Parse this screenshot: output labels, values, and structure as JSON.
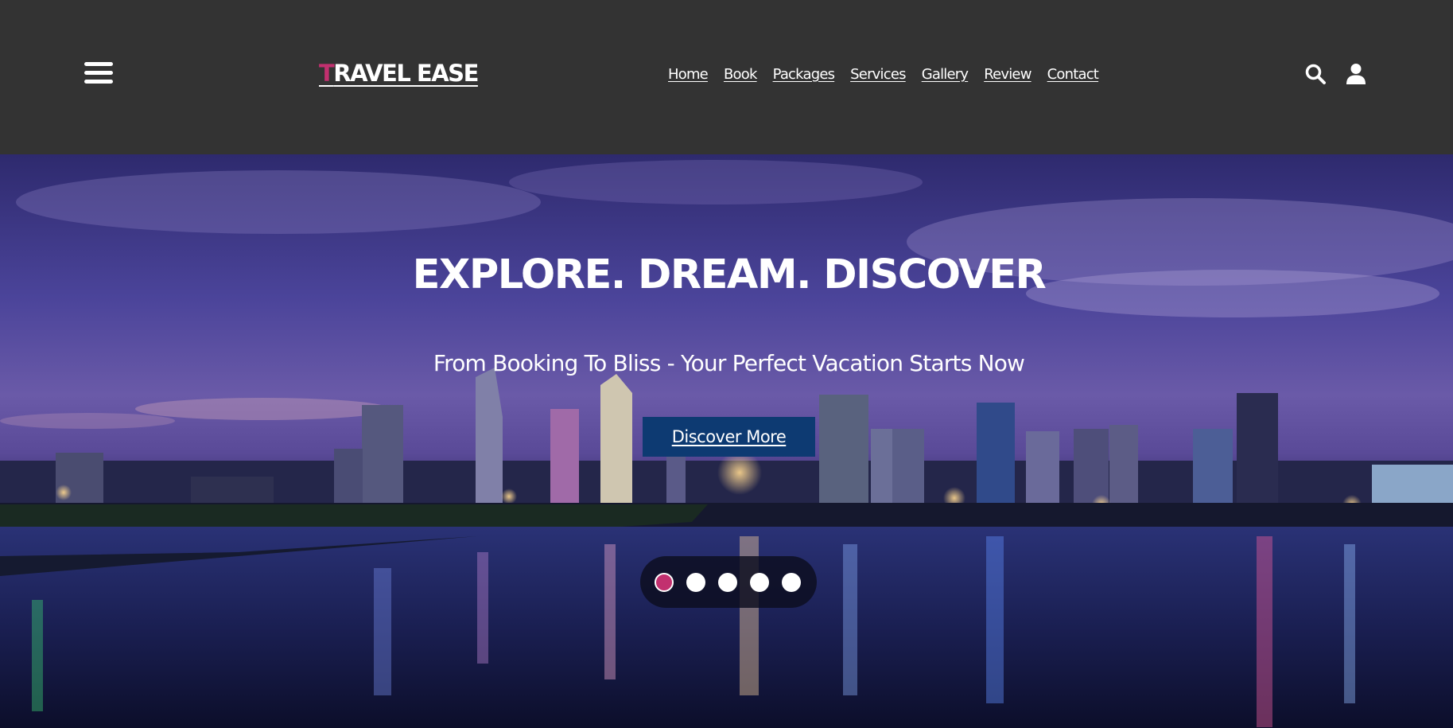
{
  "header": {
    "logo_first_letter": "T",
    "logo_rest": "RAVEL EASE",
    "nav": [
      "Home",
      "Book",
      "Packages",
      "Services",
      "Gallery",
      "Review",
      "Contact"
    ]
  },
  "icons": {
    "menu": "hamburger-menu-icon",
    "search": "search-icon",
    "user": "user-icon"
  },
  "hero": {
    "title": "EXPLORE. DREAM. DISCOVER",
    "subtitle": "From Booking To Bliss - Your Perfect Vacation Starts Now",
    "cta_label": "Discover More",
    "slides_total": 5,
    "active_slide": 1
  },
  "colors": {
    "header_bg": "#333333",
    "accent": "#c2306f",
    "cta_bg": "#0d3a72",
    "text": "#ffffff"
  }
}
